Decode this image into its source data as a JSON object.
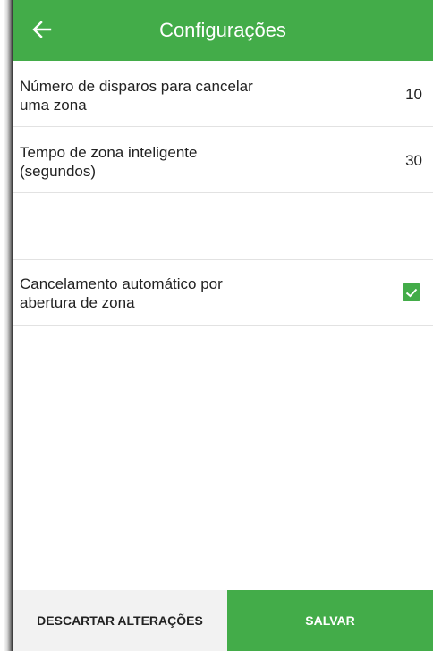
{
  "appbar": {
    "title": "Configurações",
    "back_icon": "arrow-left-icon",
    "color": "#43ac49"
  },
  "settings": [
    {
      "label_line1": "Número de disparos para cancelar",
      "label_line2": "uma zona",
      "value": "10"
    },
    {
      "label_line1": "Tempo de zona inteligente",
      "label_line2": "(segundos)",
      "value": "30"
    },
    {
      "label_line1": "Cancelamento automático por",
      "label_line2": "abertura de zona",
      "checked": true,
      "check_icon": "checkmark-icon"
    }
  ],
  "footer": {
    "discard_label": "DESCARTAR ALTERAÇÕES",
    "save_label": "SALVAR"
  }
}
